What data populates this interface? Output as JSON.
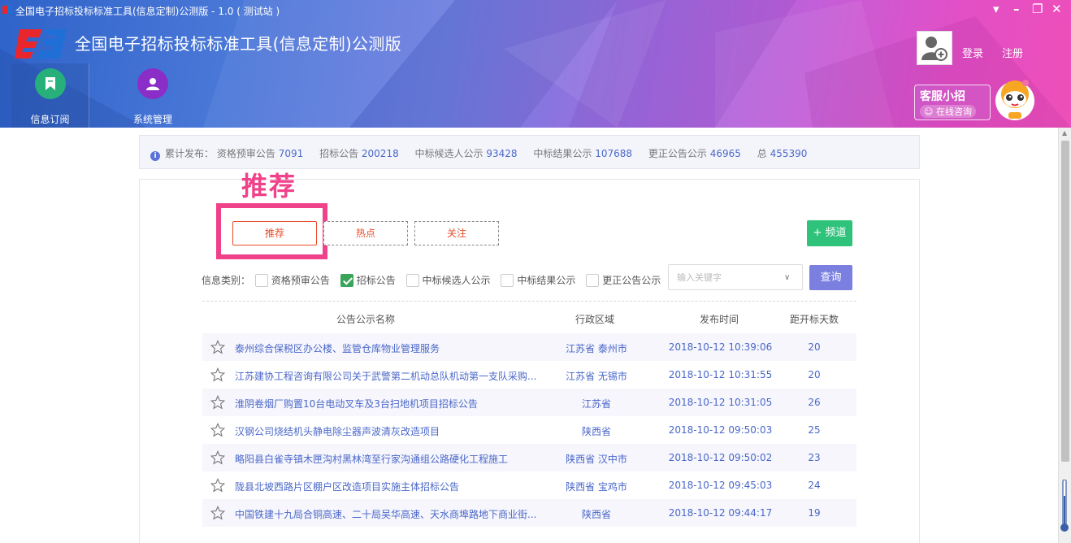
{
  "window": {
    "title": "全国电子招标投标标准工具(信息定制)公测版 - 1.0 ( 测试站 )"
  },
  "header": {
    "app_title": "全国电子招标投标标准工具(信息定制)公测版",
    "login": "登录",
    "register": "注册",
    "service_name": "客服小招",
    "service_consult": "在线咨询"
  },
  "nav": {
    "tabs": [
      {
        "label": "信息订阅",
        "icon": "bookmark-icon",
        "active": true
      },
      {
        "label": "系统管理",
        "icon": "user-icon",
        "active": false
      }
    ]
  },
  "stats": {
    "label": "累计发布：",
    "items": [
      {
        "label": "资格预审公告",
        "value": "7091"
      },
      {
        "label": "招标公告",
        "value": "200218"
      },
      {
        "label": "中标候选人公示",
        "value": "93428"
      },
      {
        "label": "中标结果公示",
        "value": "107688"
      },
      {
        "label": "更正公告公示",
        "value": "46965"
      },
      {
        "label": "总",
        "value": "455390"
      }
    ]
  },
  "annotation": {
    "text": "推荐",
    "color": "#f0428a"
  },
  "tabs": {
    "recommend": "推荐",
    "hot": "热点",
    "follow": "关注",
    "active": "recommend"
  },
  "channel_button": "+ 频道",
  "filter": {
    "label": "信息类别：",
    "options": [
      {
        "label": "资格预审公告",
        "checked": false
      },
      {
        "label": "招标公告",
        "checked": true
      },
      {
        "label": "中标候选人公示",
        "checked": false
      },
      {
        "label": "中标结果公示",
        "checked": false
      },
      {
        "label": "更正公告公示",
        "checked": false
      }
    ],
    "keyword_placeholder": "输入关键字",
    "query_button": "查询"
  },
  "table": {
    "headers": {
      "name": "公告公示名称",
      "region": "行政区域",
      "date": "发布时间",
      "days": "距开标天数"
    },
    "rows": [
      {
        "name": "泰州综合保税区办公楼、监管仓库物业管理服务",
        "region": "江苏省 泰州市",
        "date": "2018-10-12 10:39:06",
        "days": "20"
      },
      {
        "name": "江苏建协工程咨询有限公司关于武警第二机动总队机动第一支队采购...",
        "region": "江苏省 无锡市",
        "date": "2018-10-12 10:31:55",
        "days": "20"
      },
      {
        "name": "淮阴卷烟厂购置10台电动叉车及3台扫地机项目招标公告",
        "region": "江苏省",
        "date": "2018-10-12 10:31:05",
        "days": "26"
      },
      {
        "name": "汉钢公司烧结机头静电除尘器声波清灰改造项目",
        "region": "陕西省",
        "date": "2018-10-12 09:50:03",
        "days": "25"
      },
      {
        "name": "略阳县白雀寺镇木匣沟村黑林湾至行家沟通组公路硬化工程施工",
        "region": "陕西省 汉中市",
        "date": "2018-10-12 09:50:02",
        "days": "23"
      },
      {
        "name": "陇县北坡西路片区棚户区改造项目实施主体招标公告",
        "region": "陕西省 宝鸡市",
        "date": "2018-10-12 09:45:03",
        "days": "24"
      },
      {
        "name": "中国铁建十九局合铜高速、二十局吴华高速、天水商埠路地下商业街...",
        "region": "陕西省",
        "date": "2018-10-12 09:44:17",
        "days": "19"
      }
    ]
  },
  "colors": {
    "accent_blue": "#4a67c9",
    "tab_red": "#e94e2a",
    "channel_green": "#2ec27b",
    "query_purple": "#7b7fe0"
  }
}
